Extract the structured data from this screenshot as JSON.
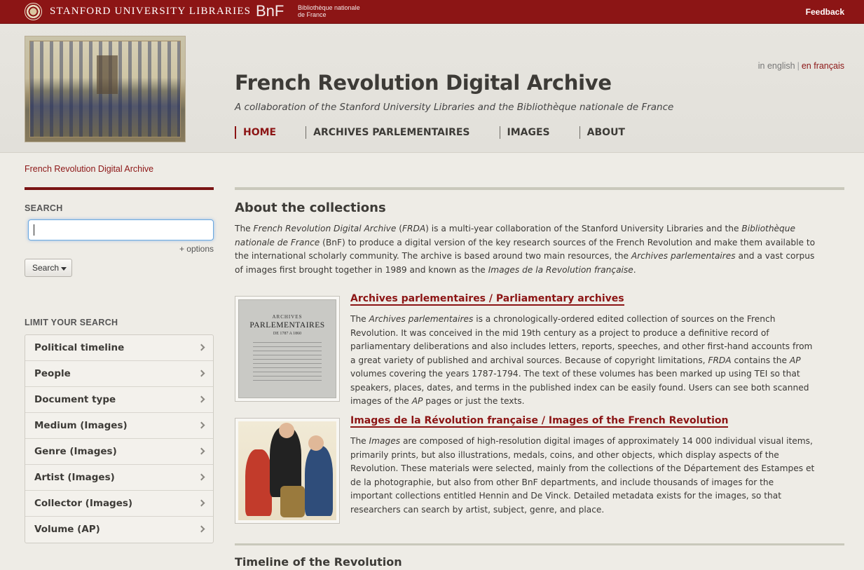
{
  "topbar": {
    "university": "STANFORD UNIVERSITY LIBRARIES",
    "bnf_logo": "BnF",
    "bnf_sub": "Bibliothèque nationale de France",
    "feedback": "Feedback"
  },
  "header": {
    "title": "French Revolution Digital Archive",
    "subtitle": "A collaboration of the Stanford University Libraries and the Bibliothèque nationale de France",
    "lang_en": "in english",
    "lang_sep": "|",
    "lang_fr": "en français"
  },
  "nav": {
    "items": [
      {
        "label": "HOME",
        "active": true
      },
      {
        "label": "ARCHIVES PARLEMENTAIRES",
        "active": false
      },
      {
        "label": "IMAGES",
        "active": false
      },
      {
        "label": "ABOUT",
        "active": false
      }
    ]
  },
  "breadcrumb": "French Revolution Digital Archive",
  "sidebar": {
    "search_label": "SEARCH",
    "search_value": "",
    "options_link": "+ options",
    "search_button": "Search",
    "limit_label": "LIMIT YOUR SEARCH",
    "facets": [
      "Political timeline",
      "People",
      "Document type",
      "Medium (Images)",
      "Genre (Images)",
      "Artist (Images)",
      "Collector (Images)",
      "Volume (AP)"
    ]
  },
  "main": {
    "about_heading": "About the collections",
    "intro": {
      "p1": "The ",
      "frda_full": "French Revolution Digital Archive",
      "p2": " (",
      "frda_abbr": "FRDA",
      "p3": ") is a multi-year collaboration of the Stanford University Libraries and the ",
      "bnf_full": "Bibliothèque nationale de France",
      "p4": " (BnF) to produce a digital version of the key research sources of the French Revolution and make them available to the international scholarly community. The archive is based around two main resources, the ",
      "ap": "Archives parlementaires",
      "p5": " and a vast corpus of images first brought together in 1989 and known as the ",
      "images_full": "Images de la Revolution française",
      "p6": "."
    },
    "ap_section": {
      "title": "Archives parlementaires / Parliamentary archives",
      "thumb_l1": "ARCHIVES",
      "thumb_l2": "PARLEMENTAIRES",
      "thumb_l3": "DE 1787 A 1860",
      "b1": "The ",
      "b_ap": "Archives parlementaires",
      "b2": " is a chronologically-ordered edited collection of sources on the French Revolution. It was conceived in the mid 19th century as a project to produce a definitive record of parliamentary deliberations and also includes letters, reports, speeches, and other first-hand accounts from a great variety of published and archival sources. Because of copyright limitations, ",
      "b_frda": "FRDA",
      "b3": " contains the ",
      "b_ap2": "AP",
      "b4": " volumes covering the years 1787-1794. The text of these volumes has been marked up using TEI so that speakers, places, dates, and terms in the published index can be easily found. Users can see both scanned images of the ",
      "b_ap3": "AP",
      "b5": " pages or just the texts."
    },
    "images_section": {
      "title": "Images de la Révolution française / Images of the French Revolution",
      "b1": "The ",
      "b_images": "Images",
      "b2": " are composed of high-resolution digital images of approximately 14 000 individual visual items, primarily prints, but also illustrations, medals, coins, and other objects, which display aspects of the Revolution. These materials were selected, mainly from the collections of the Département des Estampes et de la photographie, but also from other BnF departments, and include thousands of images for the important collections entitled Hennin and De Vinck. Detailed metadata exists for the images, so that researchers can search by artist, subject, genre, and place."
    },
    "timeline_heading": "Timeline of the Revolution"
  },
  "colors": {
    "brand": "#8c1515",
    "background": "#eeece6",
    "focus": "#6aa8e0"
  }
}
